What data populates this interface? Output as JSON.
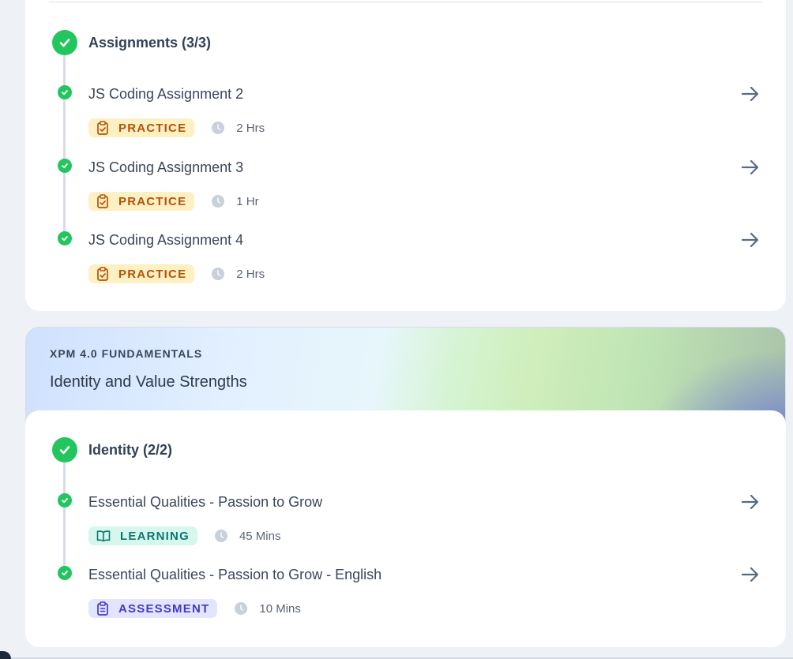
{
  "assignments_module": {
    "title": "Assignments (3/3)",
    "items": [
      {
        "title": "JS Coding Assignment 2",
        "tag": "PRACTICE",
        "duration": "2 Hrs"
      },
      {
        "title": "JS Coding Assignment 3",
        "tag": "PRACTICE",
        "duration": "1 Hr"
      },
      {
        "title": "JS Coding Assignment 4",
        "tag": "PRACTICE",
        "duration": "2 Hrs"
      }
    ]
  },
  "course": {
    "eyebrow": "XPM 4.0 FUNDAMENTALS",
    "title": "Identity and Value Strengths"
  },
  "identity_module": {
    "title": "Identity (2/2)",
    "items": [
      {
        "title": "Essential Qualities - Passion to Grow",
        "tag": "LEARNING",
        "duration": "45 Mins"
      },
      {
        "title": "Essential Qualities - Passion to Grow - English",
        "tag": "ASSESSMENT",
        "duration": "10 Mins"
      }
    ]
  },
  "icons": {
    "completed": "check-circle-icon",
    "open": "arrow-right-icon",
    "time": "clock-icon",
    "practice": "clipboard-check-icon",
    "learning": "book-open-icon",
    "assessment": "clipboard-list-icon"
  },
  "colors": {
    "success": "#22c55e",
    "practice_bg": "#fdf0c3",
    "practice_fg": "#b45309",
    "learning_bg": "#d5f7ee",
    "learning_fg": "#0f766e",
    "assessment_bg": "#e3e5ff",
    "assessment_fg": "#4338ca"
  }
}
